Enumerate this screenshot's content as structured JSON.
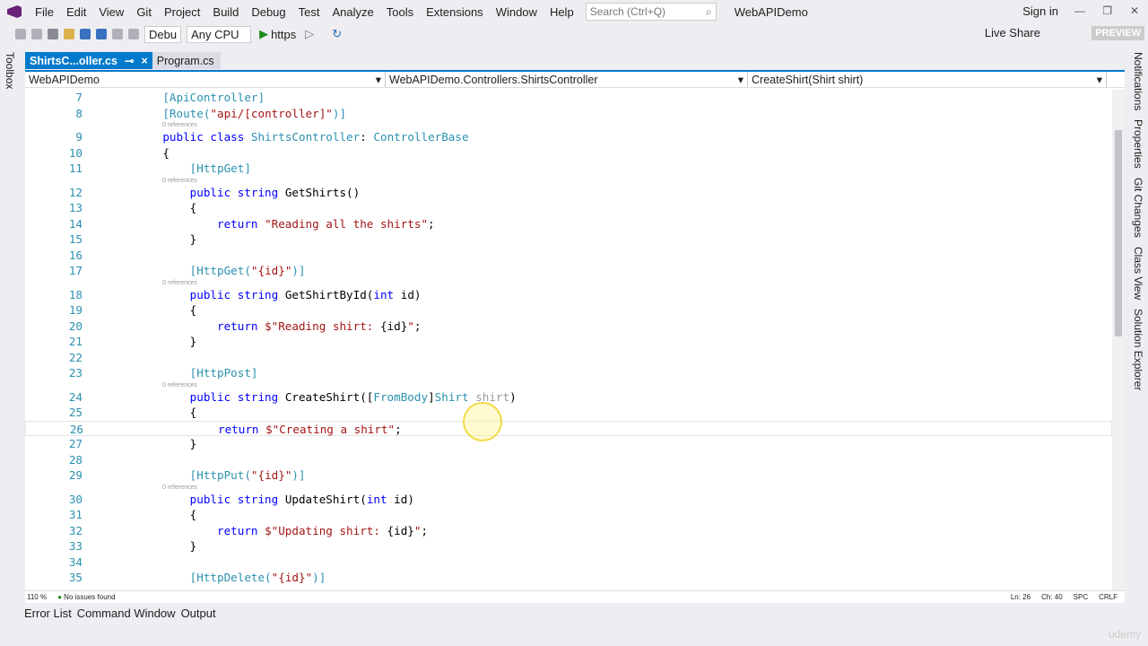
{
  "menu": [
    "File",
    "Edit",
    "View",
    "Git",
    "Project",
    "Build",
    "Debug",
    "Test",
    "Analyze",
    "Tools",
    "Extensions",
    "Window",
    "Help"
  ],
  "search": {
    "placeholder": "Search (Ctrl+Q)"
  },
  "app_title": "WebAPIDemo",
  "sign_in": "Sign in",
  "toolbar": {
    "config": "Debu",
    "platform": "Any CPU",
    "run": "https",
    "live_share": "Live Share",
    "preview": "PREVIEW"
  },
  "side": {
    "toolbox": "Toolbox",
    "right": [
      "Notifications",
      "Properties",
      "Git Changes",
      "Class View",
      "Solution Explorer"
    ]
  },
  "tabs": [
    {
      "label": "ShirtsC...oller.cs",
      "active": true
    },
    {
      "label": "Program.cs",
      "active": false
    }
  ],
  "nav": {
    "project": "WebAPIDemo",
    "class": "WebAPIDemo.Controllers.ShirtsController",
    "member": "CreateShirt(Shirt shirt)"
  },
  "refs_label": "0 references",
  "code": [
    {
      "n": "7",
      "t": [
        [
          "at",
          "    [ApiController]"
        ]
      ]
    },
    {
      "n": "8",
      "t": [
        [
          "at",
          "    [Route("
        ],
        [
          "st",
          "\"api/[controller]\""
        ],
        [
          "at",
          ")]"
        ]
      ]
    },
    {
      "n": "9",
      "refs": true,
      "t": [
        [
          "kw",
          "    public class "
        ],
        [
          "ty",
          "ShirtsController"
        ],
        [
          "pl",
          ": "
        ],
        [
          "ty",
          "ControllerBase"
        ]
      ]
    },
    {
      "n": "10",
      "t": [
        [
          "pl",
          "    {"
        ]
      ]
    },
    {
      "n": "11",
      "t": [
        [
          "at",
          "        [HttpGet]"
        ]
      ]
    },
    {
      "n": "12",
      "refs": true,
      "t": [
        [
          "kw",
          "        public string "
        ],
        [
          "pl",
          "GetShirts()"
        ]
      ]
    },
    {
      "n": "13",
      "t": [
        [
          "pl",
          "        {"
        ]
      ]
    },
    {
      "n": "14",
      "t": [
        [
          "kw",
          "            return "
        ],
        [
          "st",
          "\"Reading all the shirts\""
        ],
        [
          "pl",
          ";"
        ]
      ]
    },
    {
      "n": "15",
      "t": [
        [
          "pl",
          "        }"
        ]
      ]
    },
    {
      "n": "16",
      "t": [
        [
          "pl",
          ""
        ]
      ]
    },
    {
      "n": "17",
      "t": [
        [
          "at",
          "        [HttpGet("
        ],
        [
          "st",
          "\"{id}\""
        ],
        [
          "at",
          ")]"
        ]
      ]
    },
    {
      "n": "18",
      "refs": true,
      "t": [
        [
          "kw",
          "        public string "
        ],
        [
          "pl",
          "GetShirtById("
        ],
        [
          "kw",
          "int "
        ],
        [
          "pl",
          "id)"
        ]
      ]
    },
    {
      "n": "19",
      "t": [
        [
          "pl",
          "        {"
        ]
      ]
    },
    {
      "n": "20",
      "t": [
        [
          "kw",
          "            return "
        ],
        [
          "st",
          "$\"Reading shirt: "
        ],
        [
          "pl",
          "{id}"
        ],
        [
          "st",
          "\""
        ],
        [
          "pl",
          ";"
        ]
      ]
    },
    {
      "n": "21",
      "t": [
        [
          "pl",
          "        }"
        ]
      ]
    },
    {
      "n": "22",
      "t": [
        [
          "pl",
          ""
        ]
      ]
    },
    {
      "n": "23",
      "t": [
        [
          "at",
          "        [HttpPost]"
        ]
      ]
    },
    {
      "n": "24",
      "refs": true,
      "t": [
        [
          "kw",
          "        public string "
        ],
        [
          "pl",
          "CreateShirt(["
        ],
        [
          "at",
          "FromBody"
        ],
        [
          "pl",
          "]"
        ],
        [
          "ty",
          "Shirt "
        ],
        [
          "dim",
          "shirt"
        ],
        [
          "pl",
          ")"
        ]
      ]
    },
    {
      "n": "25",
      "t": [
        [
          "pl",
          "        {"
        ]
      ]
    },
    {
      "n": "26",
      "current": true,
      "t": [
        [
          "kw",
          "            return "
        ],
        [
          "st",
          "$\"Creating a shirt\""
        ],
        [
          "pl",
          ";"
        ]
      ]
    },
    {
      "n": "27",
      "t": [
        [
          "pl",
          "        }"
        ]
      ]
    },
    {
      "n": "28",
      "t": [
        [
          "pl",
          ""
        ]
      ]
    },
    {
      "n": "29",
      "t": [
        [
          "at",
          "        [HttpPut("
        ],
        [
          "st",
          "\"{id}\""
        ],
        [
          "at",
          ")]"
        ]
      ]
    },
    {
      "n": "30",
      "refs": true,
      "t": [
        [
          "kw",
          "        public string "
        ],
        [
          "pl",
          "UpdateShirt("
        ],
        [
          "kw",
          "int "
        ],
        [
          "pl",
          "id)"
        ]
      ]
    },
    {
      "n": "31",
      "t": [
        [
          "pl",
          "        {"
        ]
      ]
    },
    {
      "n": "32",
      "t": [
        [
          "kw",
          "            return "
        ],
        [
          "st",
          "$\"Updating shirt: "
        ],
        [
          "pl",
          "{id}"
        ],
        [
          "st",
          "\""
        ],
        [
          "pl",
          ";"
        ]
      ]
    },
    {
      "n": "33",
      "t": [
        [
          "pl",
          "        }"
        ]
      ]
    },
    {
      "n": "34",
      "t": [
        [
          "pl",
          ""
        ]
      ]
    },
    {
      "n": "35",
      "t": [
        [
          "at",
          "        [HttpDelete("
        ],
        [
          "st",
          "\"{id}\""
        ],
        [
          "at",
          ")]"
        ]
      ]
    }
  ],
  "status": {
    "zoom": "110 %",
    "issues": "No issues found",
    "ln": "Ln: 26",
    "ch": "Ch: 40",
    "spc": "SPC",
    "crlf": "CRLF"
  },
  "bottom_tabs": [
    "Error List",
    "Command Window",
    "Output"
  ],
  "watermark": "udemy",
  "colors": {
    "accent": "#007acc",
    "keyword": "#0000ff",
    "type": "#2b91af",
    "string": "#a31515"
  }
}
